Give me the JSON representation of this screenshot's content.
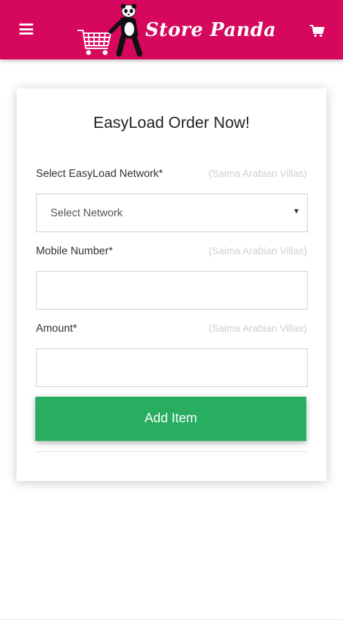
{
  "header": {
    "brand_name": "Store Panda",
    "brand_color": "#d6085e",
    "menu_icon": "hamburger-menu-icon",
    "cart_icon": "shopping-cart-icon",
    "logo_icon": "panda-with-cart-logo"
  },
  "form": {
    "title": "EasyLoad Order Now!",
    "network": {
      "label": "Select EasyLoad Network*",
      "hint": "(Saima Arabian Villas)",
      "selected": "Select Network"
    },
    "mobile": {
      "label": "Mobile Number*",
      "hint": "(Saima Arabian Villas)",
      "value": ""
    },
    "amount": {
      "label": "Amount*",
      "hint": "(Saima Arabian Villas)",
      "value": ""
    },
    "submit_label": "Add Item",
    "submit_color": "#27ae60"
  }
}
